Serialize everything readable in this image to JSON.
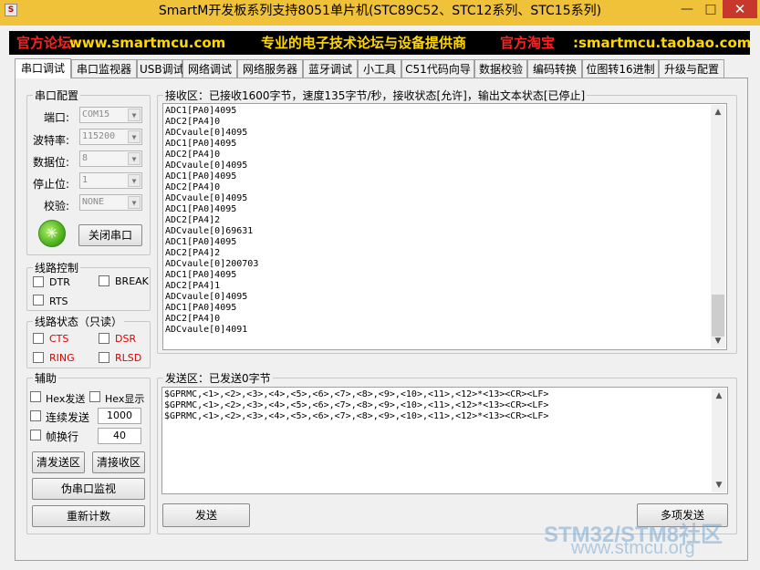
{
  "window": {
    "title": "SmartM开发板系列支持8051单片机(STC89C52、STC12系列、STC15系列)",
    "minimize": "—",
    "maximize": "□",
    "close": "✕"
  },
  "banner": {
    "forum_label": "官方论坛:",
    "forum_url": "www.smartmcu.com",
    "slogan": "专业的电子技术论坛与设备提供商",
    "shop_label": "官方淘宝",
    "shop_url": ":smartmcu.taobao.com"
  },
  "tabs": [
    "串口调试",
    "串口监视器",
    "USB调试",
    "网络调试",
    "网络服务器",
    "蓝牙调试",
    "小工具",
    "C51代码向导",
    "数据校验",
    "编码转换",
    "位图转16进制",
    "升级与配置"
  ],
  "serial_config": {
    "title": "串口配置",
    "port_label": "端口:",
    "port_value": "COM15",
    "baud_label": "波特率:",
    "baud_value": "115200",
    "databits_label": "数据位:",
    "databits_value": "8",
    "stopbits_label": "停止位:",
    "stopbits_value": "1",
    "parity_label": "校验:",
    "parity_value": "NONE",
    "close_button": "关闭串口"
  },
  "line_control": {
    "title": "线路控制",
    "dtr": "DTR",
    "break": "BREAK",
    "rts": "RTS"
  },
  "line_status": {
    "title": "线路状态（只读）",
    "cts": "CTS",
    "dsr": "DSR",
    "ring": "RING",
    "rlsd": "RLSD"
  },
  "aux": {
    "title": "辅助",
    "hex_send": "Hex发送",
    "hex_show": "Hex显示",
    "continuous": "连续发送",
    "continuous_value": "1000",
    "frame_wrap": "帧换行",
    "frame_value": "40",
    "clear_send": "清发送区",
    "clear_recv": "清接收区",
    "pseudo_monitor": "伪串口监视",
    "recount": "重新计数"
  },
  "receive": {
    "title": "接收区：已接收1600字节，速度135字节/秒，接收状态[允许]，输出文本状态[已停止]",
    "lines": [
      "ADC1[PA0]4095",
      "ADC2[PA4]0",
      "ADCvaule[0]4095",
      "ADC1[PA0]4095",
      "ADC2[PA4]0",
      "ADCvaule[0]4095",
      "ADC1[PA0]4095",
      "ADC2[PA4]0",
      "ADCvaule[0]4095",
      "ADC1[PA0]4095",
      "ADC2[PA4]2",
      "ADCvaule[0]69631",
      "ADC1[PA0]4095",
      "ADC2[PA4]2",
      "ADCvaule[0]200703",
      "ADC1[PA0]4095",
      "ADC2[PA4]1",
      "ADCvaule[0]4095",
      "ADC1[PA0]4095",
      "ADC2[PA4]0",
      "ADCvaule[0]4091"
    ]
  },
  "send": {
    "title": "发送区：已发送0字节",
    "lines": [
      "$GPRMC,<1>,<2>,<3>,<4>,<5>,<6>,<7>,<8>,<9>,<10>,<11>,<12>*<13><CR><LF>",
      "$GPRMC,<1>,<2>,<3>,<4>,<5>,<6>,<7>,<8>,<9>,<10>,<11>,<12>*<13><CR><LF>",
      "$GPRMC,<1>,<2>,<3>,<4>,<5>,<6>,<7>,<8>,<9>,<10>,<11>,<12>*<13><CR><LF>"
    ],
    "send_button": "发送",
    "multi_send_button": "多项发送"
  },
  "watermark": {
    "line1": "STM32/STM8社区",
    "line2": "www.stmcu.org"
  },
  "colors": {
    "titlebar": "#f0c23a",
    "close": "#c7382c",
    "banner_red": "#ff2020",
    "banner_yellow": "#ffd700"
  }
}
